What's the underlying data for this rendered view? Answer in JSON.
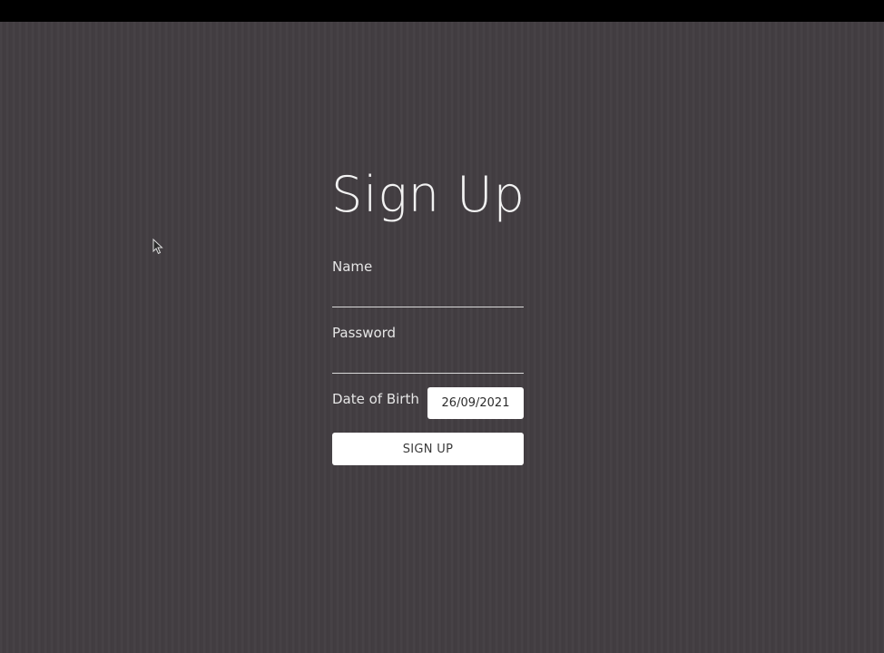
{
  "form": {
    "title": "Sign Up",
    "name": {
      "label": "Name",
      "value": ""
    },
    "password": {
      "label": "Password",
      "value": ""
    },
    "date_of_birth": {
      "label": "Date of Birth",
      "value": "26/09/2021"
    },
    "submit_label": "SIGN UP"
  },
  "colors": {
    "background": "#433e42",
    "top_bar": "#000000",
    "text": "#f2f2f2",
    "button_bg": "#ffffff",
    "button_text": "#3a3a3a"
  },
  "icons": {
    "cursor": "mouse-pointer-icon"
  }
}
